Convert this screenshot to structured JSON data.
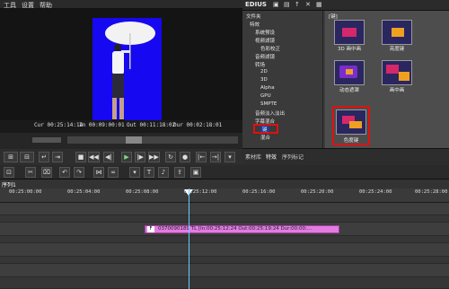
{
  "menubar": {
    "items": [
      "工具",
      "设置",
      "帮助"
    ]
  },
  "player": {
    "cur_label": "Cur",
    "cur_value": "00:25:14:14",
    "in_label": "In",
    "in_value": "00:09:00:01",
    "out_label": "Out",
    "out_value": "00:11:18:02",
    "dur_label": "Dur",
    "dur_value": "00:02:18:01"
  },
  "right_panel": {
    "app_title": "EDIUS",
    "tree": [
      "文件夹",
      "特效",
      "系统预设",
      "视频滤镜",
      "色彩校正",
      "音频滤镜",
      "转场",
      "2D",
      "3D",
      "Alpha",
      "GPU",
      "SMPTE",
      "音频淡入淡出",
      "字幕混合",
      "键",
      "混合"
    ],
    "thumb_header": "[键]",
    "thumbs": [
      {
        "label": "3D 画中画"
      },
      {
        "label": "亮度键"
      },
      {
        "label": "动态遮罩"
      },
      {
        "label": "画中画"
      },
      {
        "label": "色度键"
      }
    ],
    "tabs": [
      "素材库",
      "特效",
      "序列标记"
    ]
  },
  "timeline": {
    "tab_label": "序列1",
    "ruler_labels": [
      "00:25:00:00",
      "00:25:04:00",
      "00:25:08:00",
      "00:25:12:00",
      "00:25:16:00",
      "00:25:20:00",
      "00:25:24:00",
      "00:25:28:00"
    ],
    "clip_text": "0370090189  TL [In:00:25:12:24 Out:00:25:19:24 Dur:00:00:..."
  },
  "colors": {
    "accent_red": "#e01010",
    "video_bg": "#1608f0",
    "clip": "#e37be3",
    "playhead": "#66ccff"
  }
}
